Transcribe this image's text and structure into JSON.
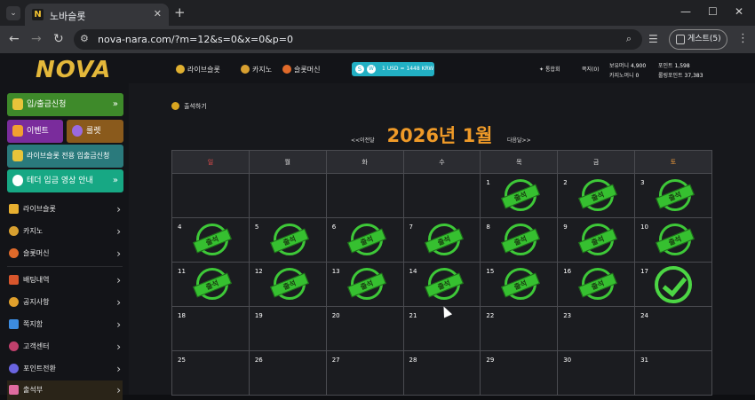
{
  "browser": {
    "tab_title": "노바슬롯",
    "favicon": "N",
    "url": "nova-nara.com/?m=12&s=0&x=0&p=0",
    "profile_label": "게스트(5)"
  },
  "sidebar": {
    "logo": "NOVA",
    "buttons": {
      "deposit": "입/출금신청",
      "event": "이벤트",
      "roulette": "룰렛",
      "live_slot_deposit": "라이브슬롯 전용 입출금신청",
      "tether_guide": "테더 입금 영상 안내"
    },
    "games": [
      {
        "label": "라이브슬롯",
        "icon": "k-logo-icon"
      },
      {
        "label": "카지노",
        "icon": "chips-icon"
      },
      {
        "label": "슬롯머신",
        "icon": "slot-icon"
      }
    ],
    "menu": [
      {
        "label": "배팅내역",
        "icon": "betting-history-icon",
        "color": "#d8562c"
      },
      {
        "label": "공지사항",
        "icon": "megaphone-icon",
        "color": "#e0a02c"
      },
      {
        "label": "쪽지함",
        "icon": "message-icon",
        "color": "#3c8ce0"
      },
      {
        "label": "고객센터",
        "icon": "support-icon",
        "color": "#c0406c"
      },
      {
        "label": "포인트전환",
        "icon": "exchange-icon",
        "color": "#6a64e0"
      },
      {
        "label": "출석부",
        "icon": "attendance-icon",
        "color": "#e06ca0"
      }
    ]
  },
  "topnav": {
    "live_slot": "라이브슬롯",
    "casino": "카지노",
    "slot_machine": "슬롯머신",
    "rate": "1 USD = 1448 KRW",
    "rate_coin1": "S",
    "rate_coin2": "W",
    "lang": "통합회",
    "mypage": "쪽지(0)",
    "money_label": "보유머니",
    "money_value": "4,900",
    "casino_money_label": "카지노머니",
    "casino_money_value": "0",
    "point_label": "포인트",
    "point_value": "1,598",
    "rolling_label": "롤링포인트",
    "rolling_value": "37,383"
  },
  "calendar": {
    "section_title": "출석하기",
    "month_title": "2026년 1월",
    "prev": "<<이전달",
    "next": "다음달>>",
    "weekdays": [
      "일",
      "월",
      "화",
      "수",
      "목",
      "금",
      "토"
    ],
    "weekday_colors": {
      "sun": "#e34b4b",
      "sat": "#e8963a",
      "default": "#e0e0e0"
    },
    "stamp_label": "출석",
    "weeks": [
      [
        null,
        null,
        null,
        null,
        {
          "day": "1",
          "state": "stamp"
        },
        {
          "day": "2",
          "state": "stamp"
        },
        {
          "day": "3",
          "state": "stamp"
        }
      ],
      [
        {
          "day": "4",
          "state": "stamp"
        },
        {
          "day": "5",
          "state": "stamp"
        },
        {
          "day": "6",
          "state": "stamp"
        },
        {
          "day": "7",
          "state": "stamp"
        },
        {
          "day": "8",
          "state": "stamp"
        },
        {
          "day": "9",
          "state": "stamp"
        },
        {
          "day": "10",
          "state": "stamp"
        }
      ],
      [
        {
          "day": "11",
          "state": "stamp"
        },
        {
          "day": "12",
          "state": "stamp"
        },
        {
          "day": "13",
          "state": "stamp"
        },
        {
          "day": "14",
          "state": "stamp"
        },
        {
          "day": "15",
          "state": "stamp"
        },
        {
          "day": "16",
          "state": "stamp"
        },
        {
          "day": "17",
          "state": "check"
        }
      ],
      [
        {
          "day": "18",
          "state": "none"
        },
        {
          "day": "19",
          "state": "none"
        },
        {
          "day": "20",
          "state": "none"
        },
        {
          "day": "21",
          "state": "none"
        },
        {
          "day": "22",
          "state": "none"
        },
        {
          "day": "23",
          "state": "none"
        },
        {
          "day": "24",
          "state": "none"
        }
      ],
      [
        {
          "day": "25",
          "state": "none"
        },
        {
          "day": "26",
          "state": "none"
        },
        {
          "day": "27",
          "state": "none"
        },
        {
          "day": "28",
          "state": "none"
        },
        {
          "day": "29",
          "state": "none"
        },
        {
          "day": "30",
          "state": "none"
        },
        {
          "day": "31",
          "state": "none"
        }
      ]
    ]
  }
}
